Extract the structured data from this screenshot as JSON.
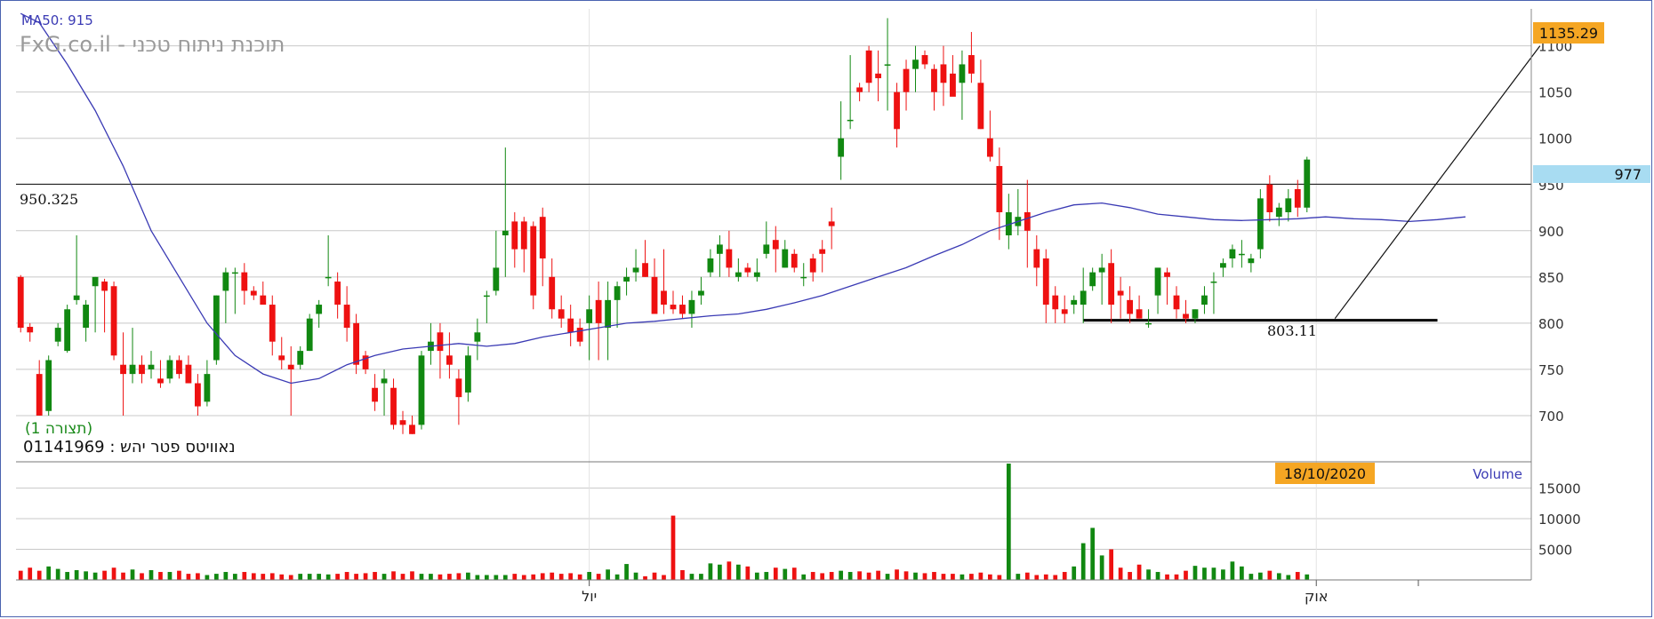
{
  "chart_data": {
    "type": "candlestick",
    "ma_label": "MA50: 915",
    "watermark": "FxG.co.il - תוכנת ניתוח טכני",
    "pattern_label": "(תצורה 1)",
    "security_label": "נאוויטס פטר יהש : 01141969",
    "last_price_label": "977",
    "price_line_label": "950.325",
    "support_label": "803.11",
    "top_badge_label": "1135.29",
    "date_badge_label": "18/10/2020",
    "volume_label": "Volume",
    "price_axis": {
      "min": 650,
      "max": 1140,
      "ticks": [
        700,
        750,
        800,
        850,
        900,
        950,
        1000,
        1050,
        1100
      ]
    },
    "volume_axis": {
      "max": 19000,
      "ticks": [
        5000,
        10000,
        15000
      ],
      "tick_labels": [
        "5000",
        "10000",
        "15000"
      ]
    },
    "x_labels": [
      {
        "index": 61,
        "label": "יול"
      },
      {
        "index": 139,
        "label": "אוק"
      }
    ],
    "horizontal_lines": [
      {
        "value": 950.325
      },
      {
        "value": 803.11,
        "from": 114,
        "to": 152
      }
    ],
    "trend_line": [
      {
        "i": 141,
        "v": 805
      },
      {
        "i": 163,
        "v": 1100
      }
    ],
    "colors": {
      "up": "#118811",
      "down": "#ee1111",
      "ma": "#3a3ab4",
      "frame": "#4a63b0",
      "grid": "#c8c8c8",
      "badge": "#f5a623",
      "last_price_bg": "#a8dcf2"
    },
    "candles": [
      [
        850,
        852,
        790,
        795
      ],
      [
        796,
        800,
        780,
        790
      ],
      [
        745,
        760,
        700,
        700
      ],
      [
        705,
        765,
        700,
        760
      ],
      [
        780,
        800,
        775,
        795
      ],
      [
        770,
        820,
        768,
        815
      ],
      [
        825,
        895,
        820,
        830
      ],
      [
        795,
        825,
        780,
        820
      ],
      [
        840,
        850,
        790,
        850
      ],
      [
        845,
        848,
        790,
        835
      ],
      [
        840,
        845,
        760,
        765
      ],
      [
        755,
        790,
        700,
        745
      ],
      [
        745,
        795,
        735,
        755
      ],
      [
        755,
        765,
        735,
        745
      ],
      [
        750,
        770,
        740,
        755
      ],
      [
        740,
        760,
        730,
        735
      ],
      [
        740,
        765,
        735,
        760
      ],
      [
        760,
        765,
        740,
        745
      ],
      [
        755,
        765,
        735,
        735
      ],
      [
        735,
        745,
        700,
        710
      ],
      [
        715,
        760,
        710,
        745
      ],
      [
        760,
        830,
        755,
        830
      ],
      [
        835,
        860,
        800,
        855
      ],
      [
        855,
        860,
        810,
        855
      ],
      [
        855,
        865,
        820,
        835
      ],
      [
        835,
        840,
        825,
        830
      ],
      [
        830,
        845,
        820,
        820
      ],
      [
        820,
        830,
        765,
        780
      ],
      [
        765,
        785,
        750,
        760
      ],
      [
        755,
        775,
        700,
        750
      ],
      [
        755,
        775,
        750,
        770
      ],
      [
        770,
        810,
        770,
        805
      ],
      [
        810,
        825,
        795,
        820
      ],
      [
        850,
        895,
        840,
        850
      ],
      [
        845,
        855,
        805,
        820
      ],
      [
        820,
        840,
        780,
        795
      ],
      [
        800,
        810,
        745,
        755
      ],
      [
        765,
        770,
        745,
        750
      ],
      [
        730,
        745,
        705,
        715
      ],
      [
        735,
        750,
        700,
        740
      ],
      [
        730,
        740,
        685,
        690
      ],
      [
        695,
        705,
        680,
        690
      ],
      [
        690,
        700,
        680,
        680
      ],
      [
        690,
        770,
        685,
        765
      ],
      [
        770,
        800,
        755,
        780
      ],
      [
        790,
        800,
        740,
        770
      ],
      [
        765,
        790,
        740,
        755
      ],
      [
        740,
        750,
        690,
        720
      ],
      [
        725,
        775,
        715,
        765
      ],
      [
        780,
        805,
        760,
        790
      ],
      [
        830,
        835,
        800,
        830
      ],
      [
        835,
        900,
        830,
        860
      ],
      [
        895,
        990,
        850,
        900
      ],
      [
        910,
        920,
        860,
        880
      ],
      [
        910,
        915,
        855,
        880
      ],
      [
        905,
        910,
        815,
        830
      ],
      [
        915,
        925,
        840,
        870
      ],
      [
        850,
        870,
        805,
        815
      ],
      [
        815,
        830,
        795,
        805
      ],
      [
        805,
        820,
        775,
        790
      ],
      [
        795,
        805,
        775,
        780
      ],
      [
        800,
        830,
        760,
        815
      ],
      [
        825,
        845,
        760,
        800
      ],
      [
        795,
        845,
        760,
        825
      ],
      [
        825,
        845,
        795,
        840
      ],
      [
        845,
        860,
        830,
        850
      ],
      [
        855,
        880,
        845,
        860
      ],
      [
        865,
        890,
        850,
        850
      ],
      [
        850,
        870,
        820,
        810
      ],
      [
        835,
        880,
        810,
        820
      ],
      [
        820,
        835,
        810,
        815
      ],
      [
        820,
        830,
        805,
        810
      ],
      [
        810,
        835,
        795,
        825
      ],
      [
        830,
        850,
        820,
        835
      ],
      [
        855,
        880,
        850,
        870
      ],
      [
        875,
        895,
        850,
        885
      ],
      [
        880,
        900,
        850,
        860
      ],
      [
        850,
        870,
        845,
        855
      ],
      [
        860,
        865,
        850,
        855
      ],
      [
        850,
        870,
        845,
        855
      ],
      [
        875,
        910,
        870,
        885
      ],
      [
        890,
        905,
        855,
        880
      ],
      [
        860,
        890,
        860,
        880
      ],
      [
        875,
        880,
        855,
        860
      ],
      [
        850,
        865,
        840,
        850
      ],
      [
        870,
        875,
        845,
        855
      ],
      [
        880,
        890,
        855,
        875
      ],
      [
        910,
        925,
        880,
        905
      ],
      [
        980,
        1040,
        955,
        1000
      ],
      [
        1020,
        1090,
        1010,
        1020
      ],
      [
        1055,
        1060,
        1040,
        1050
      ],
      [
        1095,
        1100,
        1050,
        1060
      ],
      [
        1070,
        1095,
        1040,
        1065
      ],
      [
        1080,
        1130,
        1030,
        1080
      ],
      [
        1050,
        1060,
        990,
        1010
      ],
      [
        1075,
        1085,
        1030,
        1050
      ],
      [
        1075,
        1100,
        1050,
        1085
      ],
      [
        1090,
        1095,
        1075,
        1080
      ],
      [
        1075,
        1080,
        1030,
        1050
      ],
      [
        1080,
        1100,
        1035,
        1060
      ],
      [
        1070,
        1090,
        1050,
        1045
      ],
      [
        1060,
        1095,
        1020,
        1080
      ],
      [
        1090,
        1115,
        1060,
        1070
      ],
      [
        1060,
        1085,
        1010,
        1010
      ],
      [
        1000,
        1030,
        975,
        980
      ],
      [
        970,
        990,
        890,
        920
      ],
      [
        895,
        940,
        880,
        920
      ],
      [
        905,
        945,
        895,
        915
      ],
      [
        920,
        955,
        860,
        900
      ],
      [
        880,
        895,
        840,
        860
      ],
      [
        870,
        880,
        800,
        820
      ],
      [
        830,
        840,
        800,
        815
      ],
      [
        815,
        830,
        800,
        810
      ],
      [
        820,
        830,
        810,
        825
      ],
      [
        820,
        860,
        800,
        835
      ],
      [
        840,
        860,
        835,
        855
      ],
      [
        855,
        875,
        820,
        860
      ],
      [
        865,
        880,
        800,
        820
      ],
      [
        835,
        850,
        805,
        830
      ],
      [
        825,
        840,
        800,
        810
      ],
      [
        815,
        830,
        805,
        805
      ],
      [
        800,
        815,
        795,
        800
      ],
      [
        830,
        860,
        810,
        860
      ],
      [
        855,
        860,
        820,
        850
      ],
      [
        830,
        840,
        805,
        815
      ],
      [
        810,
        825,
        800,
        805
      ],
      [
        805,
        815,
        800,
        815
      ],
      [
        820,
        840,
        810,
        830
      ],
      [
        845,
        855,
        810,
        845
      ],
      [
        860,
        870,
        850,
        865
      ],
      [
        870,
        885,
        860,
        880
      ],
      [
        875,
        890,
        860,
        875
      ],
      [
        865,
        875,
        855,
        870
      ],
      [
        880,
        945,
        870,
        935
      ],
      [
        950,
        960,
        910,
        920
      ],
      [
        915,
        930,
        905,
        925
      ],
      [
        920,
        945,
        910,
        935
      ],
      [
        945,
        955,
        915,
        925
      ],
      [
        925,
        980,
        920,
        977
      ]
    ],
    "ma": [
      [
        0,
        1135
      ],
      [
        2,
        1125
      ],
      [
        5,
        1080
      ],
      [
        8,
        1030
      ],
      [
        11,
        970
      ],
      [
        14,
        900
      ],
      [
        17,
        850
      ],
      [
        20,
        800
      ],
      [
        23,
        765
      ],
      [
        26,
        745
      ],
      [
        29,
        735
      ],
      [
        32,
        740
      ],
      [
        35,
        755
      ],
      [
        38,
        765
      ],
      [
        41,
        772
      ],
      [
        44,
        775
      ],
      [
        47,
        778
      ],
      [
        50,
        775
      ],
      [
        53,
        778
      ],
      [
        56,
        785
      ],
      [
        59,
        790
      ],
      [
        62,
        795
      ],
      [
        65,
        800
      ],
      [
        68,
        802
      ],
      [
        71,
        805
      ],
      [
        74,
        808
      ],
      [
        77,
        810
      ],
      [
        80,
        815
      ],
      [
        83,
        822
      ],
      [
        86,
        830
      ],
      [
        89,
        840
      ],
      [
        92,
        850
      ],
      [
        95,
        860
      ],
      [
        98,
        873
      ],
      [
        101,
        885
      ],
      [
        104,
        900
      ],
      [
        107,
        910
      ],
      [
        110,
        920
      ],
      [
        113,
        928
      ],
      [
        116,
        930
      ],
      [
        119,
        925
      ],
      [
        122,
        918
      ],
      [
        125,
        915
      ],
      [
        128,
        912
      ],
      [
        131,
        911
      ],
      [
        134,
        912
      ],
      [
        137,
        913
      ],
      [
        140,
        915
      ],
      [
        143,
        913
      ],
      [
        146,
        912
      ],
      [
        149,
        910
      ],
      [
        152,
        912
      ],
      [
        155,
        915
      ]
    ],
    "volume": [
      1500,
      2000,
      1500,
      2200,
      1800,
      1300,
      1600,
      1400,
      1200,
      1500,
      2000,
      1200,
      1700,
      1100,
      1600,
      1300,
      1300,
      1500,
      1000,
      1100,
      800,
      1000,
      1300,
      1000,
      1300,
      1100,
      1000,
      1100,
      900,
      800,
      1000,
      1000,
      1000,
      900,
      1000,
      1300,
      1000,
      1100,
      1300,
      1000,
      1400,
      1000,
      1400,
      1000,
      1000,
      900,
      1000,
      1100,
      1200,
      800,
      800,
      800,
      800,
      1000,
      800,
      900,
      1100,
      1200,
      1000,
      1100,
      900,
      1300,
      1000,
      1700,
      900,
      2600,
      1200,
      600,
      1200,
      800,
      10500,
      1600,
      1000,
      1000,
      2700,
      2500,
      3000,
      2500,
      2200,
      1200,
      1300,
      2000,
      1800,
      2000,
      900,
      1300,
      1100,
      1300,
      1500,
      1300,
      1400,
      1200,
      1500,
      1000,
      1700,
      1400,
      1200,
      1100,
      1300,
      1000,
      1000,
      900,
      1000,
      1200,
      900,
      800,
      19500,
      1000,
      1200,
      800,
      900,
      800,
      1300,
      2200,
      6000,
      8500,
      4000,
      5000,
      2000,
      1300,
      2500,
      1700,
      1300,
      900,
      900,
      1500,
      2300,
      2000,
      2000,
      1700,
      3000,
      2200,
      1000,
      1200,
      1500,
      1100,
      800,
      1300,
      900,
      1100,
      1100,
      1200,
      700,
      800,
      700,
      800,
      600,
      800,
      600,
      900,
      700,
      800,
      1000,
      1000,
      1000,
      900,
      1100,
      1200,
      1000,
      800
    ]
  }
}
